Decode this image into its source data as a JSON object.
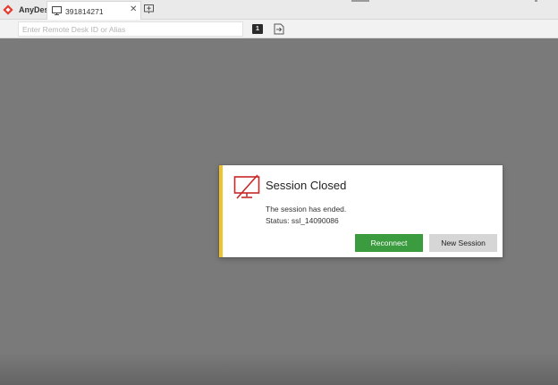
{
  "app": {
    "name": "AnyDesk",
    "brand_color": "#e43d30"
  },
  "tabs": [
    {
      "label": "391814271",
      "icon": "monitor-icon",
      "close_label": "✕"
    }
  ],
  "toolbar": {
    "address_placeholder": "Enter Remote Desk ID or Alias",
    "address_value": "",
    "badge_count": "1",
    "transfer_icon": "file-transfer-icon"
  },
  "dialog": {
    "title": "Session Closed",
    "message": "The session has ended.",
    "status": "Status: ssl_14090086",
    "icon": "monitor-disconnected-icon",
    "accent_color": "#f0c22b",
    "buttons": {
      "reconnect": "Reconnect",
      "new_session": "New Session"
    },
    "reconnect_color": "#3b9b3f"
  }
}
